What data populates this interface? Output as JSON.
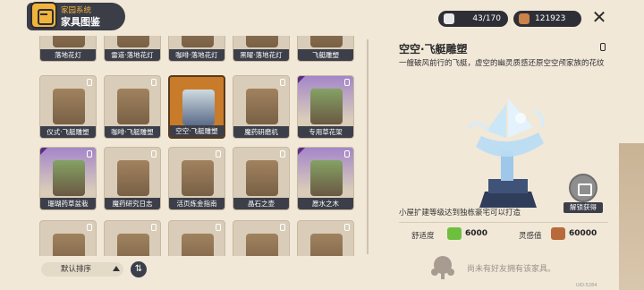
{
  "header": {
    "subtitle": "家园系统",
    "title": "家具图鉴",
    "icon": "furniture-book-icon",
    "resource1": {
      "icon": "white-crystal-icon",
      "value": "43/170"
    },
    "resource2": {
      "icon": "copper-coin-icon",
      "value": "121923"
    },
    "close_icon": "close-icon"
  },
  "cards": [
    {
      "label": "落地花灯",
      "variant": "plain",
      "locked": false
    },
    {
      "label": "雷道·落地花灯",
      "variant": "plain",
      "locked": false
    },
    {
      "label": "咖啡·落地花灯",
      "variant": "plain",
      "locked": false
    },
    {
      "label": "黑曜·落地花灯",
      "variant": "plain",
      "locked": false
    },
    {
      "label": "飞艇雕塑",
      "variant": "plain",
      "locked": false
    },
    {
      "label": "仪式·飞艇雕塑",
      "variant": "plain",
      "locked": true
    },
    {
      "label": "咖啡·飞艇雕塑",
      "variant": "plain",
      "locked": true
    },
    {
      "label": "空空·飞艇雕塑",
      "variant": "selected",
      "locked": false
    },
    {
      "label": "魔药研磨机",
      "variant": "plain",
      "locked": true
    },
    {
      "label": "专用草花架",
      "variant": "purple",
      "locked": true
    },
    {
      "label": "珊瑚药草盆栽",
      "variant": "purple",
      "locked": true
    },
    {
      "label": "魔药研究日志",
      "variant": "plain",
      "locked": true
    },
    {
      "label": "活页炼金指南",
      "variant": "plain",
      "locked": true
    },
    {
      "label": "晶石之壶",
      "variant": "plain",
      "locked": true
    },
    {
      "label": "愿水之木",
      "variant": "purple",
      "locked": true
    },
    {
      "label": "",
      "variant": "plain",
      "locked": true
    },
    {
      "label": "",
      "variant": "plain",
      "locked": true
    },
    {
      "label": "",
      "variant": "plain",
      "locked": true
    },
    {
      "label": "",
      "variant": "plain",
      "locked": true
    },
    {
      "label": "",
      "variant": "plain",
      "locked": true
    }
  ],
  "sort": {
    "label": "默认排序",
    "order_icon": "sort-order-icon"
  },
  "detail": {
    "title": "空空·飞艇雕塑",
    "description": "一艘破风前行的飞艇，虚空的幽灵质感还原空空颅家族的花纹",
    "unlock_condition": "小屋扩建等级达到独栋豪宅可以打造",
    "unlock_button": "解锁获得",
    "stats": [
      {
        "label": "舒适度",
        "icon": "leaf-icon",
        "value": "6000"
      },
      {
        "label": "灵感值",
        "icon": "quill-icon",
        "value": "60000"
      }
    ],
    "footer": "尚未有好友拥有该家具。",
    "uid": "UID:5284"
  }
}
